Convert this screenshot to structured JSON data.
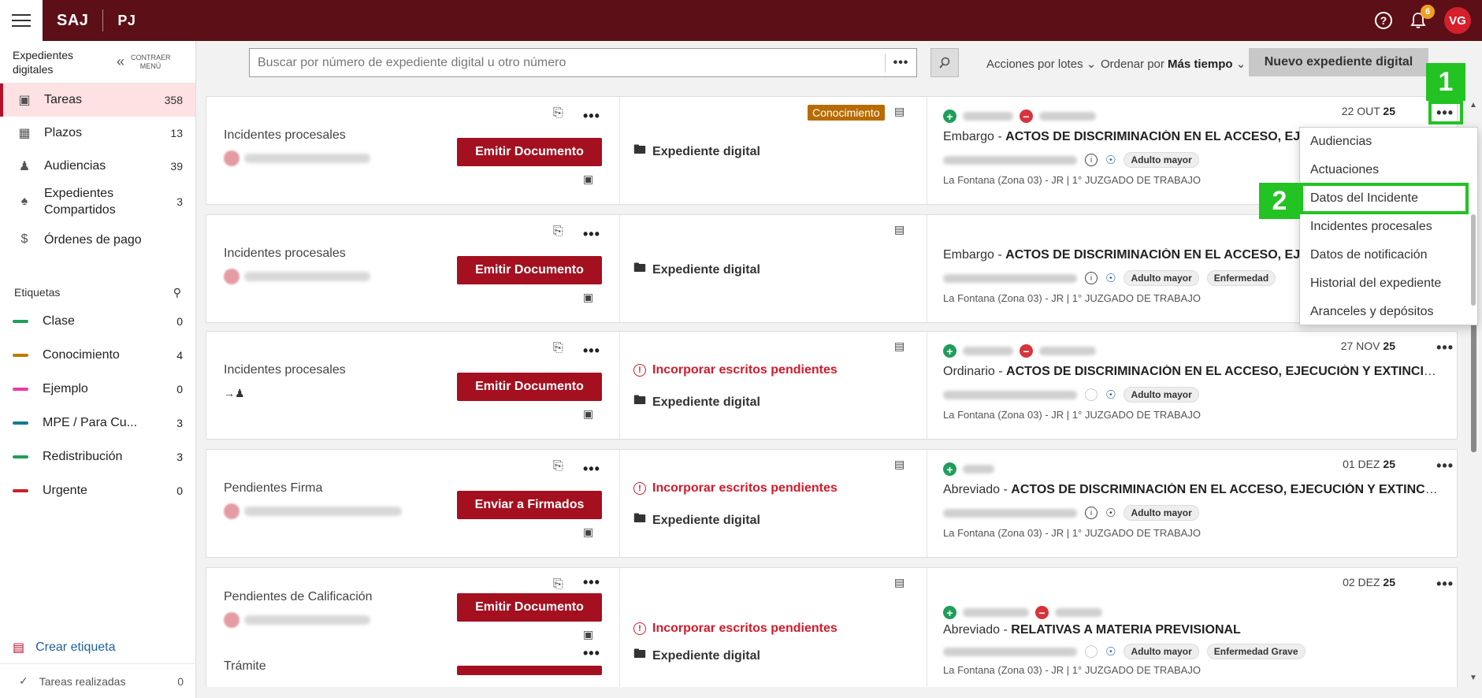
{
  "topbar": {
    "brand": "SAJ",
    "section": "PJ",
    "notifications_count": "6",
    "user_initials": "VG"
  },
  "sidebar": {
    "title": "Expedientes digitales",
    "collapse_label": "CONTRAER MENÚ",
    "items": [
      {
        "label": "Tareas",
        "count": "358",
        "icon": "bookmark-icon"
      },
      {
        "label": "Plazos",
        "count": "13",
        "icon": "calendar-icon"
      },
      {
        "label": "Audiencias",
        "count": "39",
        "icon": "people-icon"
      },
      {
        "label": "Expedientes Compartidos",
        "count": "3",
        "icon": "share-user-icon"
      },
      {
        "label": "Órdenes de pago",
        "count": "",
        "icon": "dollar-icon"
      }
    ],
    "tags_title": "Etiquetas",
    "tags": [
      {
        "label": "Clase",
        "count": "0",
        "color": "#1f9e5a"
      },
      {
        "label": "Conocimiento",
        "count": "4",
        "color": "#c17a00"
      },
      {
        "label": "Ejemplo",
        "count": "0",
        "color": "#e83aaa"
      },
      {
        "label": "MPE / Para Cu...",
        "count": "3",
        "color": "#157a8c"
      },
      {
        "label": "Redistribución",
        "count": "3",
        "color": "#1f9e5a"
      },
      {
        "label": "Urgente",
        "count": "0",
        "color": "#c8202e"
      }
    ],
    "create_tag": "Crear etiqueta",
    "done_tasks": {
      "label": "Tareas realizadas",
      "count": "0"
    }
  },
  "toolbar": {
    "search_placeholder": "Buscar por número de expediente digital u otro número",
    "search_more": "•••",
    "batch_actions": "Acciones por lotes",
    "sort_prefix": "Ordenar por",
    "sort_value": "Más tiempo",
    "new_button": "Nuevo expediente digital"
  },
  "cards": [
    {
      "task_type": "Incidentes procesales",
      "button": "Emitir Documento",
      "badge": "Conocimiento",
      "incorporate": "",
      "exp_label": "Expediente digital",
      "date_prefix": "22 OUT",
      "date_year": "25",
      "kind": "Embargo",
      "subject": "ACTOS DE DISCRIMINACIÓN EN EL ACCESO, EJECUC",
      "pills": [
        "Adulto mayor"
      ],
      "court": "La Fontana (Zona 03) - JR | 1° JUZGADO DE TRABAJO"
    },
    {
      "task_type": "Incidentes procesales",
      "button": "Emitir Documento",
      "badge": "",
      "incorporate": "",
      "exp_label": "Expediente digital",
      "date_prefix": "",
      "date_year": "",
      "kind": "Embargo",
      "subject": "ACTOS DE DISCRIMINACIÓN EN EL ACCESO, EJECUC",
      "pills": [
        "Adulto mayor",
        "Enfermedad"
      ],
      "court": "La Fontana (Zona 03) - JR | 1° JUZGADO DE TRABAJO"
    },
    {
      "task_type": "Incidentes procesales",
      "button": "Emitir Documento",
      "badge": "",
      "incorporate": "Incorporar escritos pendientes",
      "exp_label": "Expediente digital",
      "date_prefix": "27 NOV",
      "date_year": "25",
      "kind": "Ordinario",
      "subject": "ACTOS DE DISCRIMINACIÓN EN EL ACCESO, EJECUCIÓN Y EXTINCIÓN...",
      "pills": [
        "Adulto mayor"
      ],
      "court": "La Fontana (Zona 03) - JR | 1° JUZGADO DE TRABAJO"
    },
    {
      "task_type": "Pendientes Firma",
      "button": "Enviar a Firmados",
      "badge": "",
      "incorporate": "Incorporar escritos pendientes",
      "exp_label": "Expediente digital",
      "date_prefix": "01 DEZ",
      "date_year": "25",
      "kind": "Abreviado",
      "subject": "ACTOS DE DISCRIMINACIÓN EN EL ACCESO, EJECUCIÓN Y EXTINCIÓ...",
      "pills": [
        "Adulto mayor"
      ],
      "court": "La Fontana (Zona 03) - JR | 1° JUZGADO DE TRABAJO"
    },
    {
      "task_type": "Pendientes de Calificación",
      "task_type_2": "Trámite",
      "button": "Emitir Documento",
      "badge": "",
      "incorporate": "Incorporar escritos pendientes",
      "exp_label": "Expediente digital",
      "date_prefix": "02 DEZ",
      "date_year": "25",
      "kind": "Abreviado",
      "subject": "RELATIVAS A MATERIA PREVISIONAL",
      "pills": [
        "Adulto mayor",
        "Enfermedad Grave"
      ],
      "court": "La Fontana (Zona 03) - JR | 1° JUZGADO DE TRABAJO"
    }
  ],
  "dropdown": {
    "items": [
      "Audiencias",
      "Actuaciones",
      "Datos del Incidente",
      "Incidentes procesales",
      "Datos de notificación",
      "Historial del expediente",
      "Aranceles y depósitos"
    ]
  },
  "callouts": {
    "step1": "1",
    "step2": "2"
  },
  "colors": {
    "brand": "#5c0f17",
    "primary_button": "#a4101f",
    "highlight": "#22c322",
    "warning": "#d21a2a"
  }
}
